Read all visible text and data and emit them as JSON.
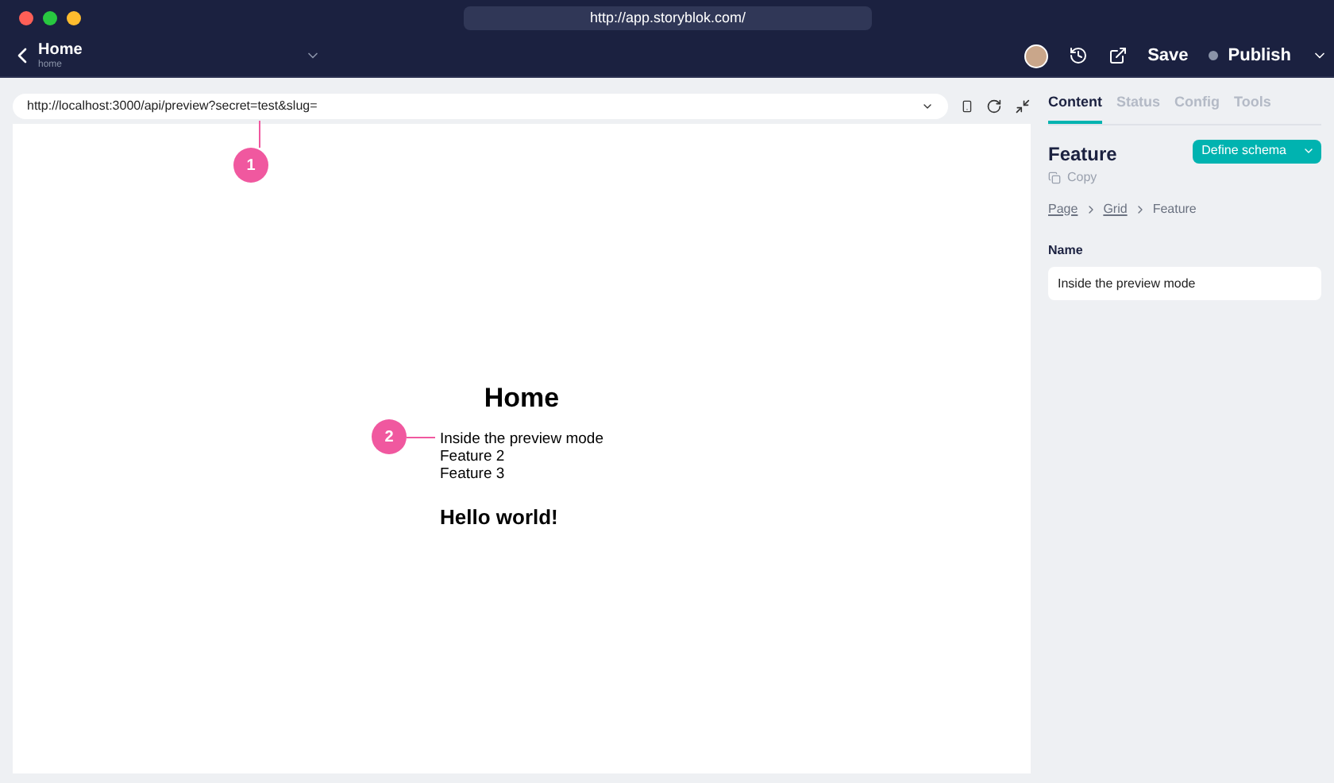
{
  "window": {
    "address": "http://app.storyblok.com/"
  },
  "header": {
    "title": "Home",
    "subtitle": "home",
    "actions": [
      {
        "kind": "history"
      },
      {
        "kind": "external"
      },
      {
        "kind": "save",
        "label": "Save"
      },
      {
        "kind": "publish",
        "label": "Publish"
      }
    ]
  },
  "preview": {
    "url": "http://localhost:3000/api/preview?secret=test&slug=",
    "heading": "Home",
    "items": [
      "Inside the preview mode",
      "Feature 2",
      "Feature 3"
    ],
    "subheading": "Hello world!"
  },
  "annotations": [
    {
      "label": "1"
    },
    {
      "label": "2"
    }
  ],
  "panel": {
    "tabs": [
      {
        "label": "Content",
        "selected": true
      },
      {
        "label": "Status",
        "selected": false
      },
      {
        "label": "Config",
        "selected": false
      },
      {
        "label": "Tools",
        "selected": false
      }
    ],
    "title": "Feature",
    "copy": "Copy",
    "schema_button": "Define schema",
    "breadcrumb": [
      {
        "label": "Page",
        "link": true
      },
      {
        "label": "Grid",
        "link": true
      },
      {
        "label": "Feature",
        "link": false
      }
    ],
    "field": {
      "label": "Name",
      "value": "Inside the preview mode"
    }
  }
}
